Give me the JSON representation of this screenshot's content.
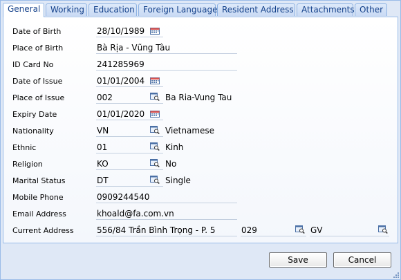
{
  "tabs": [
    {
      "label": "General",
      "active": true
    },
    {
      "label": "Working"
    },
    {
      "label": "Education"
    },
    {
      "label": "Foreign Language"
    },
    {
      "label": "Resident Address"
    },
    {
      "label": "Attachments"
    },
    {
      "label": "Other"
    }
  ],
  "form": {
    "date_of_birth": {
      "label": "Date of Birth",
      "value": "28/10/1989"
    },
    "place_of_birth": {
      "label": "Place of Birth",
      "value": "Bà Rịa - Vũng Tàu"
    },
    "id_card_no": {
      "label": "ID Card No",
      "value": "241285969"
    },
    "date_of_issue": {
      "label": "Date of Issue",
      "value": "01/01/2004"
    },
    "place_of_issue": {
      "label": "Place of Issue",
      "code": "002",
      "description": "Ba Ria-Vung Tau"
    },
    "expiry_date": {
      "label": "Expiry Date",
      "value": "01/01/2020"
    },
    "nationality": {
      "label": "Nationality",
      "code": "VN",
      "description": "Vietnamese"
    },
    "ethnic": {
      "label": "Ethnic",
      "code": "01",
      "description": "Kinh"
    },
    "religion": {
      "label": "Religion",
      "code": "KO",
      "description": "No"
    },
    "marital_status": {
      "label": "Marital Status",
      "code": "DT",
      "description": "Single"
    },
    "mobile_phone": {
      "label": "Mobile Phone",
      "value": "0909244540"
    },
    "email_address": {
      "label": "Email Address",
      "value": "khoald@fa.com.vn"
    },
    "current_address": {
      "label": "Current Address",
      "value": "556/84 Trần Bình Trọng - P. 5",
      "code": "029",
      "code2": "GV"
    }
  },
  "buttons": {
    "save": "Save",
    "cancel": "Cancel"
  },
  "icons": {
    "calendar": "calendar-icon",
    "lookup": "lookup-icon"
  },
  "colors": {
    "tab_text": "#15428b",
    "border": "#99bbe8",
    "background": "#dfe8f6"
  }
}
